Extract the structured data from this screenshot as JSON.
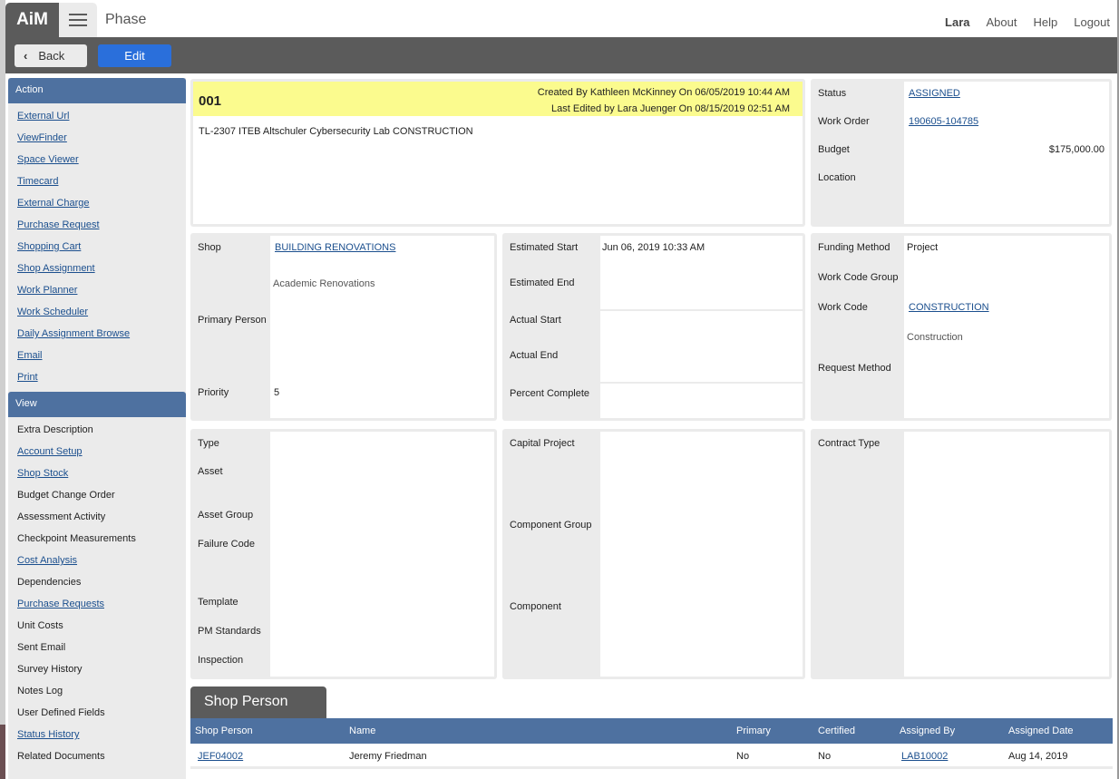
{
  "app": {
    "logo": "AiM",
    "title": "Phase",
    "user": "Lara",
    "nav_links": [
      "About",
      "Help",
      "Logout"
    ]
  },
  "toolbar": {
    "back_label": "Back",
    "edit_label": "Edit"
  },
  "sidebar": {
    "action_header": "Action",
    "action_items": [
      {
        "label": "External Url",
        "link": true
      },
      {
        "label": "ViewFinder",
        "link": true
      },
      {
        "label": "Space Viewer",
        "link": true
      },
      {
        "label": "Timecard",
        "link": true
      },
      {
        "label": "External Charge",
        "link": true
      },
      {
        "label": "Purchase Request",
        "link": true
      },
      {
        "label": "Shopping Cart",
        "link": true
      },
      {
        "label": "Shop Assignment",
        "link": true
      },
      {
        "label": "Work Planner",
        "link": true
      },
      {
        "label": "Work Scheduler",
        "link": true
      },
      {
        "label": "Daily Assignment Browse",
        "link": true
      },
      {
        "label": "Email",
        "link": true
      },
      {
        "label": "Print",
        "link": true
      }
    ],
    "view_header": "View",
    "view_items": [
      {
        "label": "Extra Description",
        "link": false
      },
      {
        "label": "Account Setup",
        "link": true
      },
      {
        "label": "Shop Stock",
        "link": true
      },
      {
        "label": "Budget Change Order",
        "link": false
      },
      {
        "label": "Assessment Activity",
        "link": false
      },
      {
        "label": "Checkpoint Measurements",
        "link": false
      },
      {
        "label": "Cost Analysis",
        "link": true
      },
      {
        "label": "Dependencies",
        "link": false
      },
      {
        "label": "Purchase Requests",
        "link": true
      },
      {
        "label": "Unit Costs",
        "link": false
      },
      {
        "label": "Sent Email",
        "link": false
      },
      {
        "label": "Survey History",
        "link": false
      },
      {
        "label": "Notes Log",
        "link": false
      },
      {
        "label": "User Defined Fields",
        "link": false
      },
      {
        "label": "Status History",
        "link": true
      },
      {
        "label": "Related Documents",
        "link": false
      }
    ]
  },
  "header": {
    "phase_id": "001",
    "created": "Created By Kathleen McKinney On 06/05/2019 10:44 AM",
    "edited": "Last Edited by Lara Juenger On 08/15/2019 02:51 AM",
    "description": "TL-2307 ITEB Altschuler Cybersecurity Lab CONSTRUCTION"
  },
  "status_panel": {
    "status_label": "Status",
    "status_value": "ASSIGNED",
    "work_order_label": "Work Order",
    "work_order_value": "190605-104785",
    "budget_label": "Budget",
    "budget_value": "$175,000.00",
    "location_label": "Location",
    "location_value": ""
  },
  "shop_panel": {
    "shop_label": "Shop",
    "shop_value": "BUILDING RENOVATIONS",
    "shop_desc": "Academic Renovations",
    "primary_person_label": "Primary Person",
    "primary_person_value": "",
    "priority_label": "Priority",
    "priority_value": "5"
  },
  "dates_panel": {
    "est_start_label": "Estimated Start",
    "est_start_value": "Jun 06, 2019 10:33 AM",
    "est_end_label": "Estimated End",
    "est_end_value": "",
    "act_start_label": "Actual Start",
    "act_start_value": "",
    "act_end_label": "Actual End",
    "act_end_value": "",
    "pct_label": "Percent Complete",
    "pct_value": ""
  },
  "funding_panel": {
    "funding_label": "Funding Method",
    "funding_value": "Project",
    "wcg_label": "Work Code Group",
    "wcg_value": "",
    "work_code_label": "Work Code",
    "work_code_value": "CONSTRUCTION",
    "work_code_desc": "Construction",
    "request_label": "Request Method",
    "request_value": ""
  },
  "asset_panel": {
    "labels": [
      "Type",
      "Asset",
      "Asset Group",
      "Failure Code",
      "Template",
      "PM Standards",
      "Inspection"
    ]
  },
  "capital_panel": {
    "labels": [
      "Capital Project",
      "Component Group",
      "Component"
    ]
  },
  "contract_panel": {
    "labels": [
      "Contract Type"
    ]
  },
  "shop_person": {
    "tab_label": "Shop Person",
    "columns": [
      "Shop Person",
      "Name",
      "Primary",
      "Certified",
      "Assigned By",
      "Assigned Date"
    ],
    "rows": [
      {
        "shop_person": "JEF04002",
        "name": "Jeremy Friedman",
        "primary": "No",
        "certified": "No",
        "assigned_by": "LAB10002",
        "assigned_date": "Aug 14, 2019"
      }
    ]
  }
}
